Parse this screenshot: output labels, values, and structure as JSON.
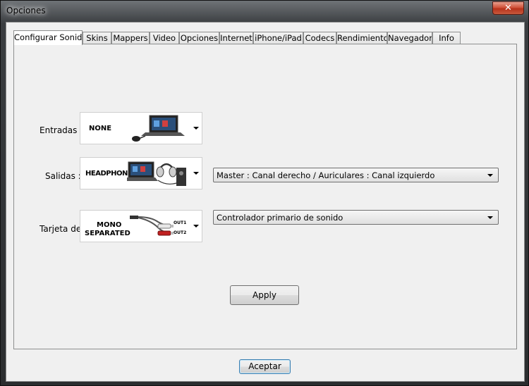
{
  "window": {
    "title": "Opciones",
    "close_glyph": "✕"
  },
  "tabs": [
    {
      "label": "Configurar Sonido",
      "active": true
    },
    {
      "label": "Skins"
    },
    {
      "label": "Mappers"
    },
    {
      "label": "Video"
    },
    {
      "label": "Opciones"
    },
    {
      "label": "Internet"
    },
    {
      "label": "iPhone/iPad"
    },
    {
      "label": "Codecs"
    },
    {
      "label": "Rendimiento"
    },
    {
      "label": "Navegador"
    },
    {
      "label": "Info"
    }
  ],
  "sound": {
    "inputs": {
      "label": "Entradas :",
      "image_caption": "NONE"
    },
    "outputs": {
      "label": "Salidas :",
      "image_caption": "HEADPHONES",
      "routing": "Master : Canal derecho / Auriculares : Canal izquierdo"
    },
    "card": {
      "label": "Tarjeta de",
      "caption_line1": "MONO",
      "caption_line2": "SEPARATED",
      "out1": "OUT1",
      "out2": "OUT2",
      "device": "Controlador primario de sonido"
    },
    "apply_label": "Apply"
  },
  "footer": {
    "accept_label": "Aceptar"
  }
}
